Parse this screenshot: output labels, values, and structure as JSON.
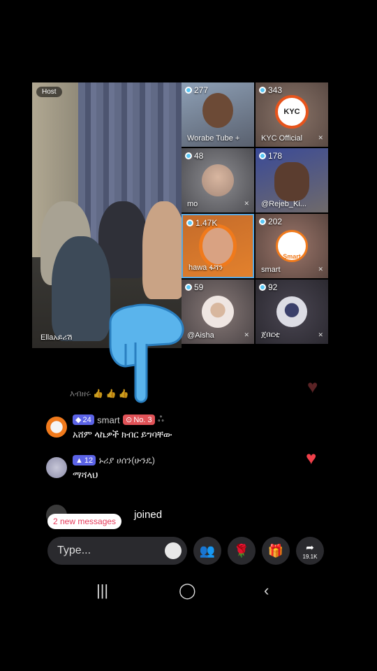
{
  "host": {
    "tag": "Host",
    "name": "Ellaአይሪሽ"
  },
  "tiles": [
    {
      "count": "277",
      "name": "Worabe Tube",
      "extra": "+"
    },
    {
      "count": "343",
      "name": "KYC Official",
      "logo": "KYC"
    },
    {
      "count": "48",
      "name": "mo"
    },
    {
      "count": "178",
      "name": "@Rejeb_Ki..."
    },
    {
      "count": "1.47K",
      "name": "hawa ፋሻን"
    },
    {
      "count": "202",
      "name": "smart",
      "logo": "Smart"
    },
    {
      "count": "59",
      "name": "@Aisha"
    },
    {
      "count": "92",
      "name": "ጀበርቲ"
    }
  ],
  "chat": {
    "faded": "እብዘሩ 👍 👍 👍",
    "m1": {
      "level": "24",
      "user": "smart",
      "rank": "No. 3",
      "text": "አሸም ላኬዎች ክብር ይግባቸው"
    },
    "m2": {
      "level": "12",
      "user": "ኑሪያ ሀሰን(ሁንዴ)",
      "text": "ማሻላህ"
    },
    "joined": "joined",
    "new_messages": "2 new messages"
  },
  "composer": {
    "placeholder": "Type...",
    "share_count": "19.1K"
  },
  "colors": {
    "accent": "#e63a5a",
    "badge_blue": "#5b63e6",
    "badge_red": "#e05257",
    "heart": "#f0404a"
  }
}
